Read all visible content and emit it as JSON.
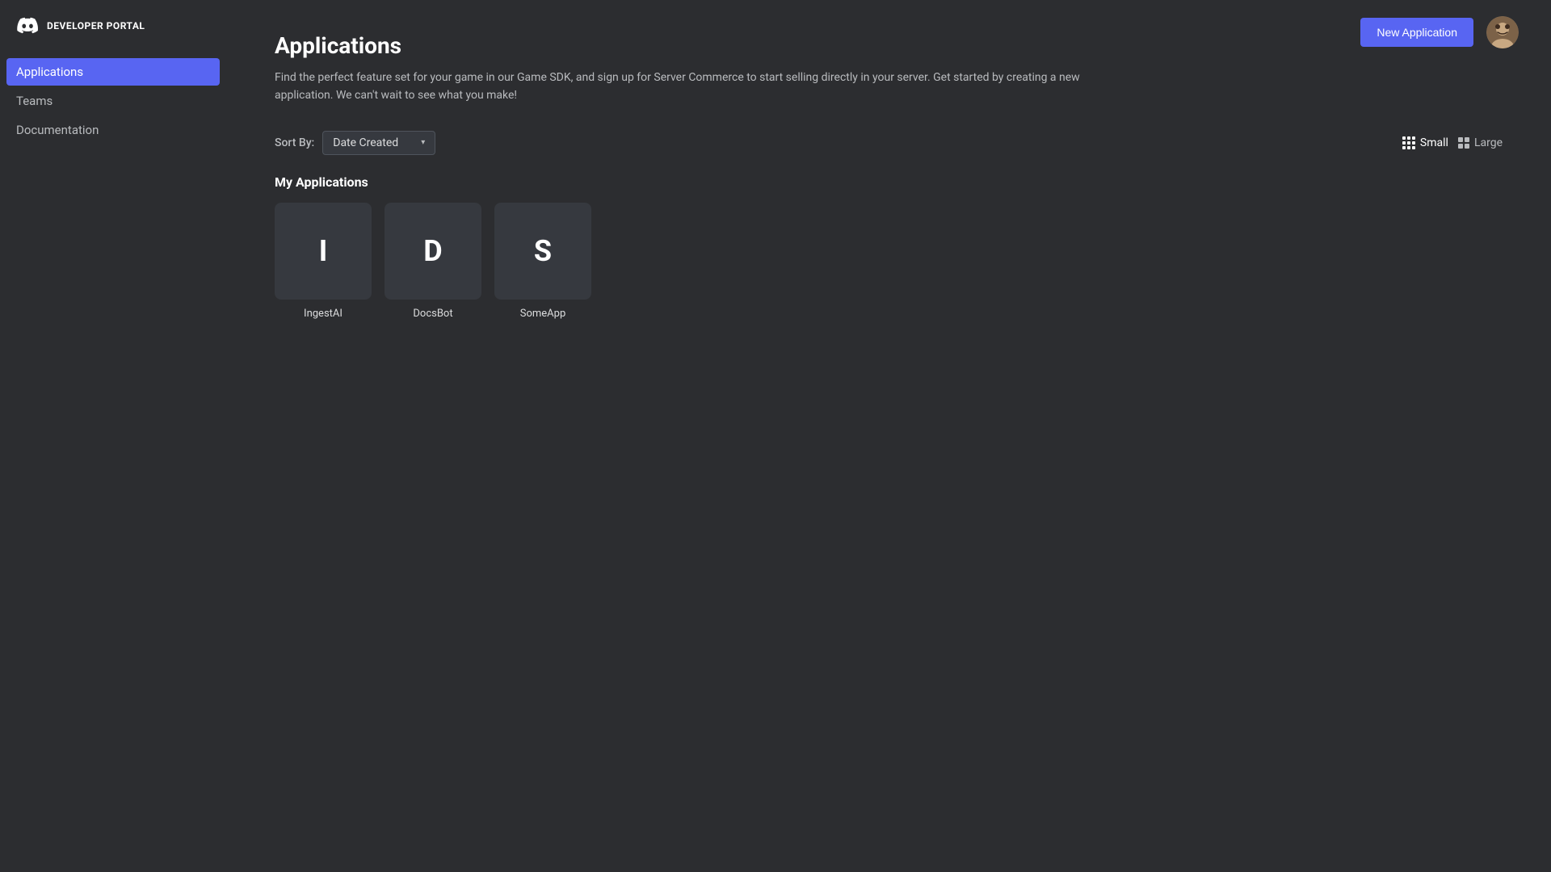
{
  "sidebar": {
    "logo_label": "DEVELOPER PORTAL",
    "items": [
      {
        "id": "applications",
        "label": "Applications",
        "active": true
      },
      {
        "id": "teams",
        "label": "Teams",
        "active": false
      },
      {
        "id": "documentation",
        "label": "Documentation",
        "active": false
      }
    ]
  },
  "header": {
    "new_app_button": "New Application"
  },
  "page": {
    "title": "Applications",
    "description": "Find the perfect feature set for your game in our Game SDK, and sign up for Server Commerce to start selling directly in your server. Get started by creating a new application. We can't wait to see what you make!"
  },
  "controls": {
    "sort_label": "Sort By:",
    "sort_selected": "Date Created",
    "view_small_label": "Small",
    "view_large_label": "Large"
  },
  "my_applications": {
    "section_title": "My Applications",
    "apps": [
      {
        "id": "ingestai",
        "initial": "I",
        "name": "IngestAI"
      },
      {
        "id": "docsbot",
        "initial": "D",
        "name": "DocsBot"
      },
      {
        "id": "someapp",
        "initial": "S",
        "name": "SomeApp"
      }
    ]
  }
}
